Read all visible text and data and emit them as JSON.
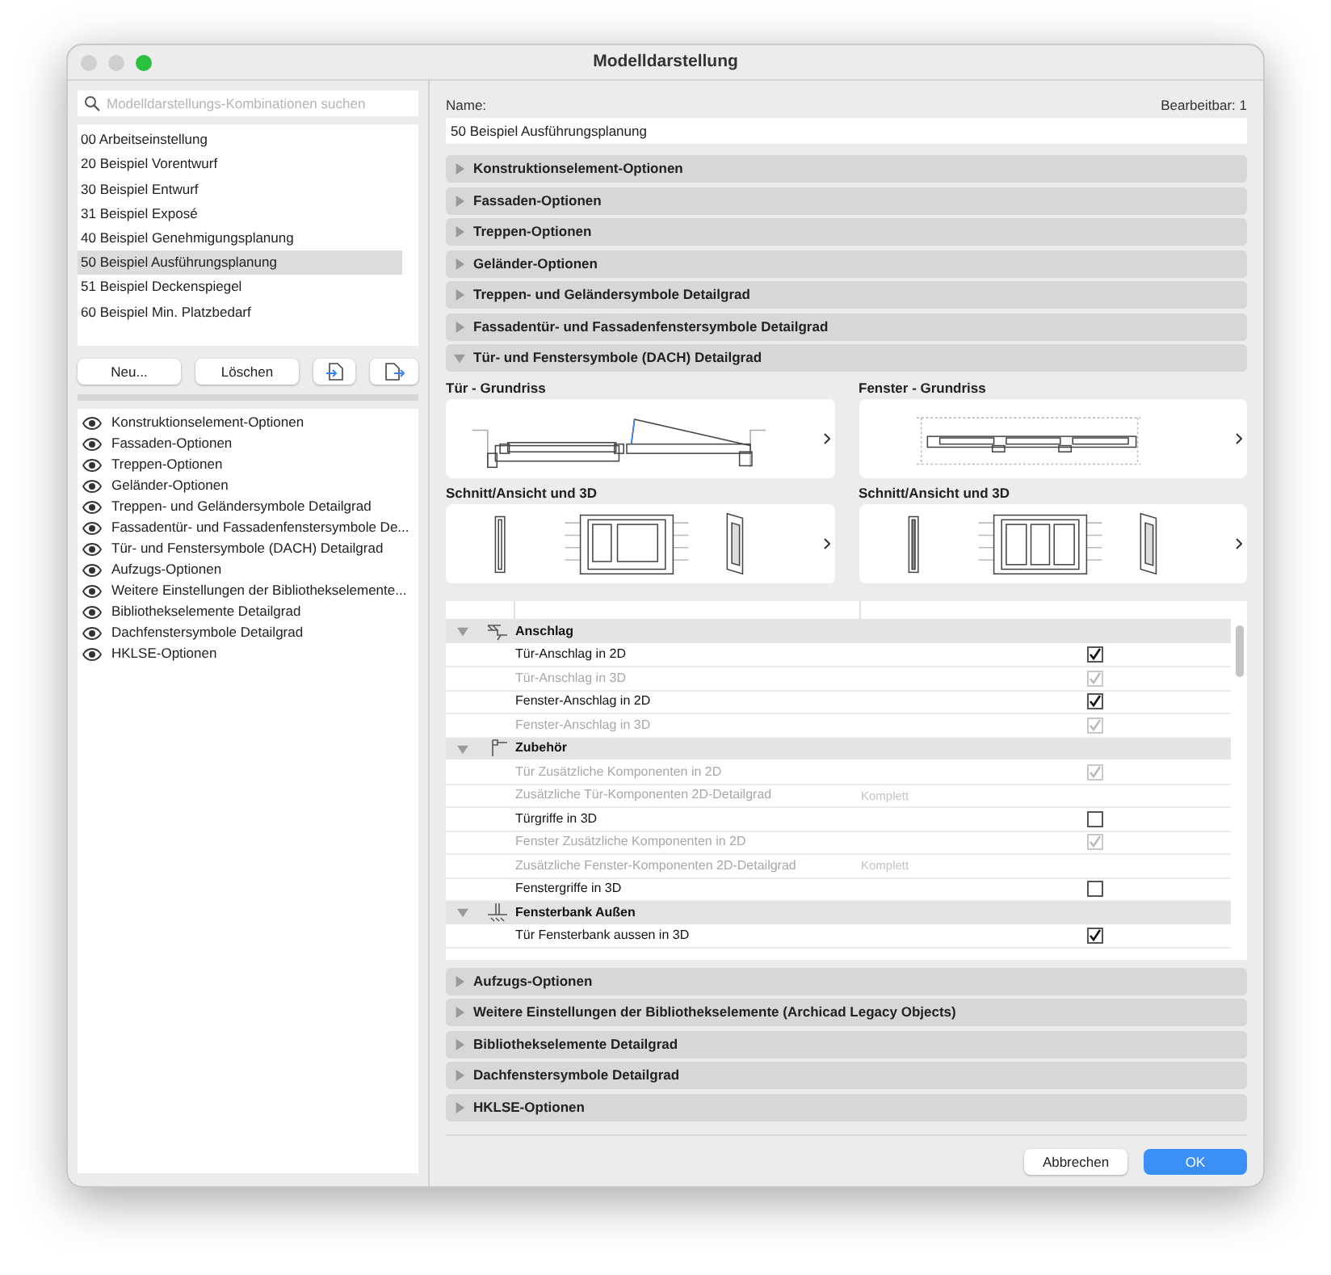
{
  "window": {
    "title": "Modelldarstellung"
  },
  "search": {
    "placeholder": "Modelldarstellungs-Kombinationen suchen"
  },
  "combinations": [
    {
      "label": "00 Arbeitseinstellung",
      "selected": false
    },
    {
      "label": "20 Beispiel Vorentwurf",
      "selected": false
    },
    {
      "label": "30 Beispiel Entwurf",
      "selected": false
    },
    {
      "label": "31 Beispiel Exposé",
      "selected": false
    },
    {
      "label": "40 Beispiel Genehmigungsplanung",
      "selected": false
    },
    {
      "label": "50 Beispiel Ausführungsplanung",
      "selected": true
    },
    {
      "label": "51 Beispiel Deckenspiegel",
      "selected": false
    },
    {
      "label": "60 Beispiel Min. Platzbedarf",
      "selected": false
    }
  ],
  "list_buttons": [
    "Neu...",
    "Löschen"
  ],
  "option_sets": [
    "Konstruktionselement-Optionen",
    "Fassaden-Optionen",
    "Treppen-Optionen",
    "Geländer-Optionen",
    "Treppen- und Geländersymbole Detailgrad",
    "Fassadentür- und Fassadenfenstersymbole De...",
    "Tür- und Fenstersymbole (DACH) Detailgrad",
    "Aufzugs-Optionen",
    "Weitere Einstellungen der Bibliothekselemente...",
    "Bibliothekselemente Detailgrad",
    "Dachfenstersymbole Detailgrad",
    "HKLSE-Optionen"
  ],
  "name_label": "Name:",
  "editable": "Bearbeitbar: 1",
  "name_value": "50 Beispiel Ausführungsplanung",
  "sections": [
    {
      "title": "Konstruktionselement-Optionen",
      "expanded": false
    },
    {
      "title": "Fassaden-Optionen",
      "expanded": false
    },
    {
      "title": "Treppen-Optionen",
      "expanded": false
    },
    {
      "title": "Geländer-Optionen",
      "expanded": false
    },
    {
      "title": "Treppen- und Geländersymbole Detailgrad",
      "expanded": false
    },
    {
      "title": "Fassadentür- und Fassadenfenstersymbole Detailgrad",
      "expanded": false
    },
    {
      "title": "Tür- und Fenstersymbole (DACH) Detailgrad",
      "expanded": true,
      "previews": [
        {
          "label": "Tür - Grundriss",
          "kind": "door-plan"
        },
        {
          "label": "Fenster - Grundriss",
          "kind": "window-plan"
        },
        {
          "label": "Schnitt/Ansicht und 3D",
          "kind": "door-3d"
        },
        {
          "label": "Schnitt/Ansicht und 3D",
          "kind": "window-3d"
        }
      ],
      "rows": [
        {
          "kind": "group",
          "label": "Anschlag",
          "expanded": true
        },
        {
          "kind": "option",
          "label": "Tür-Anschlag in 2D",
          "disabled": false,
          "checked": true
        },
        {
          "kind": "option",
          "label": "Tür-Anschlag in 3D",
          "disabled": true,
          "checked": true
        },
        {
          "kind": "option",
          "label": "Fenster-Anschlag in 2D",
          "disabled": false,
          "checked": true
        },
        {
          "kind": "option",
          "label": "Fenster-Anschlag in 3D",
          "disabled": true,
          "checked": true
        },
        {
          "kind": "group",
          "label": "Zubehör",
          "expanded": true
        },
        {
          "kind": "option",
          "label": "Tür Zusätzliche Komponenten in 2D",
          "disabled": true,
          "checked": true
        },
        {
          "kind": "value",
          "label": "Zusätzliche Tür-Komponenten 2D-Detailgrad",
          "disabled": true,
          "value": "Komplett"
        },
        {
          "kind": "option",
          "label": "Türgriffe in 3D",
          "disabled": false,
          "checked": false
        },
        {
          "kind": "option",
          "label": "Fenster Zusätzliche Komponenten in 2D",
          "disabled": true,
          "checked": true
        },
        {
          "kind": "value",
          "label": "Zusätzliche Fenster-Komponenten 2D-Detailgrad",
          "disabled": true,
          "value": "Komplett"
        },
        {
          "kind": "option",
          "label": "Fenstergriffe in 3D",
          "disabled": false,
          "checked": false
        },
        {
          "kind": "group",
          "label": "Fensterbank Außen",
          "expanded": true
        },
        {
          "kind": "option",
          "label": "Tür Fensterbank aussen in 3D",
          "disabled": false,
          "checked": true
        }
      ]
    },
    {
      "title": "Aufzugs-Optionen",
      "expanded": false
    },
    {
      "title": "Weitere Einstellungen der Bibliothekselemente (Archicad Legacy Objects)",
      "expanded": false
    },
    {
      "title": "Bibliothekselemente Detailgrad",
      "expanded": false
    },
    {
      "title": "Dachfenstersymbole Detailgrad",
      "expanded": false
    },
    {
      "title": "HKLSE-Optionen",
      "expanded": false
    }
  ],
  "footer_buttons": [
    {
      "label": "Abbrechen",
      "kind": "secondary"
    },
    {
      "label": "OK",
      "kind": "primary"
    }
  ]
}
